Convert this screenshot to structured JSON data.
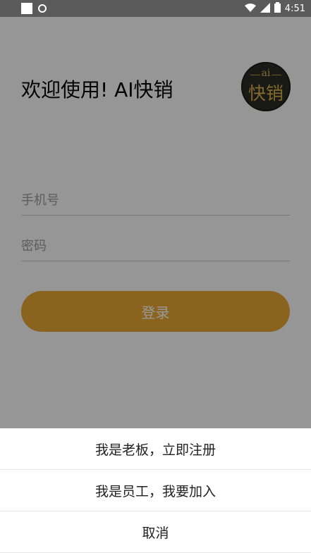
{
  "status_bar": {
    "time": "4:51",
    "icons": [
      "square-notification-icon",
      "sync-circle-icon",
      "wifi-icon",
      "signal-icon",
      "battery-icon"
    ]
  },
  "screen": {
    "welcome_title": "欢迎使用! AI快销",
    "logo": {
      "small_text": "ai",
      "main_text": "快销"
    },
    "phone_placeholder": "手机号",
    "password_placeholder": "密码",
    "login_label": "登录"
  },
  "action_sheet": {
    "items": [
      {
        "label": "我是老板，立即注册"
      },
      {
        "label": "我是员工，我要加入"
      },
      {
        "label": "取消"
      }
    ]
  },
  "colors": {
    "status_bar": "#5b5b5b",
    "button": "#e6a632",
    "overlay": "rgba(0,0,0,0.4)",
    "logo_bg": "#2b2a25",
    "logo_gold": "#d9b14c"
  }
}
